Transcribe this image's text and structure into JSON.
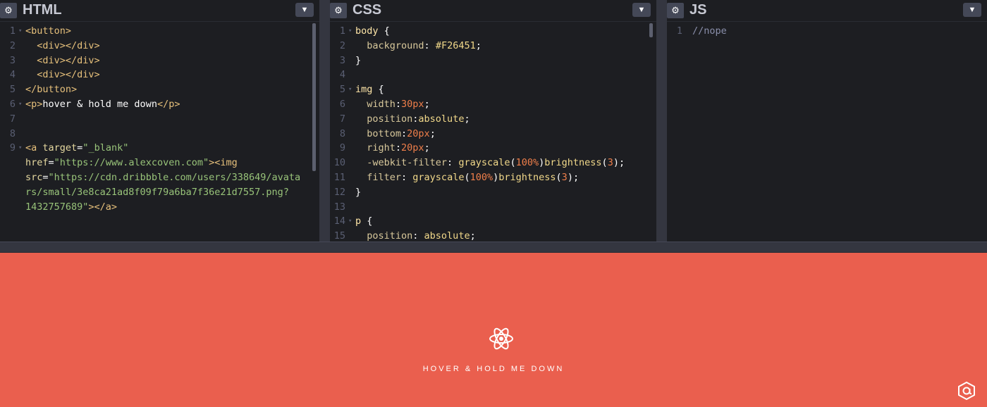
{
  "html_panel": {
    "title": "HTML",
    "lines": [
      {
        "n": "1",
        "fold": true,
        "parts": [
          {
            "c": "t-tag",
            "t": "<button>"
          }
        ]
      },
      {
        "n": "2",
        "parts": [
          {
            "c": "t-tag",
            "t": "  <div></div>"
          }
        ]
      },
      {
        "n": "3",
        "parts": [
          {
            "c": "t-tag",
            "t": "  <div></div>"
          }
        ]
      },
      {
        "n": "4",
        "parts": [
          {
            "c": "t-tag",
            "t": "  <div></div>"
          }
        ]
      },
      {
        "n": "5",
        "parts": [
          {
            "c": "t-tag",
            "t": "</button>"
          }
        ]
      },
      {
        "n": "6",
        "fold": true,
        "parts": [
          {
            "c": "t-tag",
            "t": "<p>"
          },
          {
            "c": "t-white",
            "t": "hover & hold me down"
          },
          {
            "c": "t-tag",
            "t": "</p>"
          }
        ]
      },
      {
        "n": "7",
        "parts": []
      },
      {
        "n": "8",
        "parts": []
      },
      {
        "n": "9",
        "fold": true,
        "parts": [
          {
            "c": "t-tag",
            "t": "<a "
          },
          {
            "c": "t-attr",
            "t": "target"
          },
          {
            "c": "t-white",
            "t": "="
          },
          {
            "c": "t-str",
            "t": "\"_blank\""
          }
        ]
      },
      {
        "n": "",
        "parts": [
          {
            "c": "t-attr",
            "t": "href"
          },
          {
            "c": "t-white",
            "t": "="
          },
          {
            "c": "t-str",
            "t": "\"https://www.alexcoven.com\""
          },
          {
            "c": "t-tag",
            "t": "><img"
          }
        ]
      },
      {
        "n": "",
        "parts": [
          {
            "c": "t-attr",
            "t": "src"
          },
          {
            "c": "t-white",
            "t": "="
          },
          {
            "c": "t-str",
            "t": "\"https://cdn.dribbble.com/users/338649/avata"
          }
        ]
      },
      {
        "n": "",
        "parts": [
          {
            "c": "t-str",
            "t": "rs/small/3e8ca21ad8f09f79a6ba7f36e21d7557.png?"
          }
        ]
      },
      {
        "n": "",
        "parts": [
          {
            "c": "t-str",
            "t": "1432757689\""
          },
          {
            "c": "t-tag",
            "t": "></a>"
          }
        ]
      }
    ]
  },
  "css_panel": {
    "title": "CSS",
    "lines": [
      {
        "n": "1",
        "fold": true,
        "parts": [
          {
            "c": "t-sel",
            "t": "body"
          },
          {
            "c": "t-white",
            "t": " {"
          }
        ]
      },
      {
        "n": "2",
        "parts": [
          {
            "c": "t-prop",
            "t": "  background"
          },
          {
            "c": "t-white",
            "t": ": "
          },
          {
            "c": "t-val",
            "t": "#F26451"
          },
          {
            "c": "t-white",
            "t": ";"
          }
        ]
      },
      {
        "n": "3",
        "parts": [
          {
            "c": "t-white",
            "t": "}"
          }
        ]
      },
      {
        "n": "4",
        "parts": []
      },
      {
        "n": "5",
        "fold": true,
        "parts": [
          {
            "c": "t-sel",
            "t": "img"
          },
          {
            "c": "t-white",
            "t": " {"
          }
        ]
      },
      {
        "n": "6",
        "parts": [
          {
            "c": "t-prop",
            "t": "  width"
          },
          {
            "c": "t-white",
            "t": ":"
          },
          {
            "c": "t-num",
            "t": "30px"
          },
          {
            "c": "t-white",
            "t": ";"
          }
        ]
      },
      {
        "n": "7",
        "parts": [
          {
            "c": "t-prop",
            "t": "  position"
          },
          {
            "c": "t-white",
            "t": ":"
          },
          {
            "c": "t-val",
            "t": "absolute"
          },
          {
            "c": "t-white",
            "t": ";"
          }
        ]
      },
      {
        "n": "8",
        "parts": [
          {
            "c": "t-prop",
            "t": "  bottom"
          },
          {
            "c": "t-white",
            "t": ":"
          },
          {
            "c": "t-num",
            "t": "20px"
          },
          {
            "c": "t-white",
            "t": ";"
          }
        ]
      },
      {
        "n": "9",
        "parts": [
          {
            "c": "t-prop",
            "t": "  right"
          },
          {
            "c": "t-white",
            "t": ":"
          },
          {
            "c": "t-num",
            "t": "20px"
          },
          {
            "c": "t-white",
            "t": ";"
          }
        ]
      },
      {
        "n": "10",
        "parts": [
          {
            "c": "t-prop",
            "t": "  -webkit-filter"
          },
          {
            "c": "t-white",
            "t": ": "
          },
          {
            "c": "t-val",
            "t": "grayscale"
          },
          {
            "c": "t-white",
            "t": "("
          },
          {
            "c": "t-num",
            "t": "100%"
          },
          {
            "c": "t-white",
            "t": ")"
          },
          {
            "c": "t-val",
            "t": "brightness"
          },
          {
            "c": "t-white",
            "t": "("
          },
          {
            "c": "t-num",
            "t": "3"
          },
          {
            "c": "t-white",
            "t": ");"
          }
        ]
      },
      {
        "n": "11",
        "parts": [
          {
            "c": "t-prop",
            "t": "  filter"
          },
          {
            "c": "t-white",
            "t": ": "
          },
          {
            "c": "t-val",
            "t": "grayscale"
          },
          {
            "c": "t-white",
            "t": "("
          },
          {
            "c": "t-num",
            "t": "100%"
          },
          {
            "c": "t-white",
            "t": ")"
          },
          {
            "c": "t-val",
            "t": "brightness"
          },
          {
            "c": "t-white",
            "t": "("
          },
          {
            "c": "t-num",
            "t": "3"
          },
          {
            "c": "t-white",
            "t": ");"
          }
        ]
      },
      {
        "n": "12",
        "parts": [
          {
            "c": "t-white",
            "t": "}"
          }
        ]
      },
      {
        "n": "13",
        "parts": []
      },
      {
        "n": "14",
        "fold": true,
        "parts": [
          {
            "c": "t-sel",
            "t": "p"
          },
          {
            "c": "t-white",
            "t": " {"
          }
        ]
      },
      {
        "n": "15",
        "parts": [
          {
            "c": "t-prop",
            "t": "  position"
          },
          {
            "c": "t-white",
            "t": ": "
          },
          {
            "c": "t-val",
            "t": "absolute"
          },
          {
            "c": "t-white",
            "t": ";"
          }
        ]
      }
    ]
  },
  "js_panel": {
    "title": "JS",
    "lines": [
      {
        "n": "1",
        "parts": [
          {
            "c": "t-comment",
            "t": "//nope"
          }
        ]
      }
    ]
  },
  "preview": {
    "hover_text": "HOVER & HOLD ME DOWN",
    "background": "#ea5f4e"
  },
  "icons": {
    "settings": "gear-icon",
    "collapse": "chevron-down-icon",
    "button_graphic": "atom-icon",
    "author_link": "at-sign-hexagon-icon"
  }
}
